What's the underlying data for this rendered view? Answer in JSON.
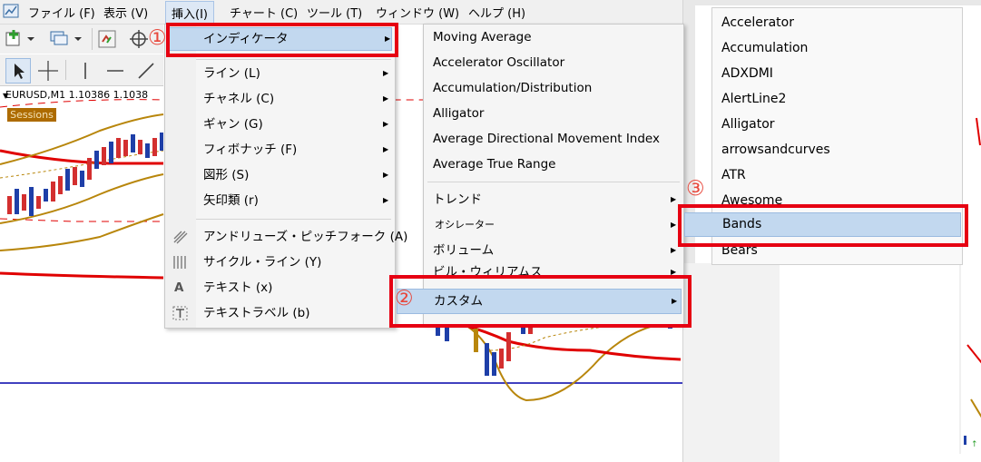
{
  "menubar": {
    "items": [
      "ファイル (F)",
      "表示 (V)",
      "挿入(I)",
      "チャート (C)",
      "ツール (T)",
      "ウィンドウ (W)",
      "ヘルプ (H)"
    ],
    "active_index": 2
  },
  "chart": {
    "title": "EURUSD,M1  1.10386 1.1038",
    "sessions_label": "Sessions"
  },
  "insert_menu": {
    "top_item": "インディケータ",
    "group1": [
      "ライン (L)",
      "チャネル (C)",
      "ギャン (G)",
      "フィボナッチ (F)",
      "図形 (S)",
      "矢印類 (r)"
    ],
    "group2": [
      {
        "label": "アンドリューズ・ピッチフォーク (A)",
        "icon": "pitchfork-icon"
      },
      {
        "label": "サイクル・ライン (Y)",
        "icon": "cycle-lines-icon"
      },
      {
        "label": "テキスト (x)",
        "icon": "text-icon"
      },
      {
        "label": "テキストラベル (b)",
        "icon": "text-label-icon"
      }
    ]
  },
  "indicators_menu": {
    "items": [
      "Moving Average",
      "Accelerator Oscillator",
      "Accumulation/Distribution",
      "Alligator",
      "Average Directional Movement Index",
      "Average True Range"
    ],
    "groups": [
      "トレンド",
      "オシレーター",
      "ボリューム",
      "ビル・ウィリアムス",
      "カスタム"
    ]
  },
  "custom_menu": {
    "items": [
      "Accelerator",
      "Accumulation",
      "ADXDMI",
      "AlertLine2",
      "Alligator",
      "arrowsandcurves",
      "ATR",
      "Awesome",
      "Bands",
      "Bears"
    ],
    "highlighted": "Bands"
  },
  "annotations": {
    "step1": "①",
    "step2": "②",
    "step3": "③"
  },
  "colors": {
    "highlight_red": "#e60012",
    "menu_highlight": "#c2d8ef",
    "bollinger_gold": "#b8860b",
    "moving_average_red": "#e00000",
    "hline_blue": "#0000aa"
  }
}
